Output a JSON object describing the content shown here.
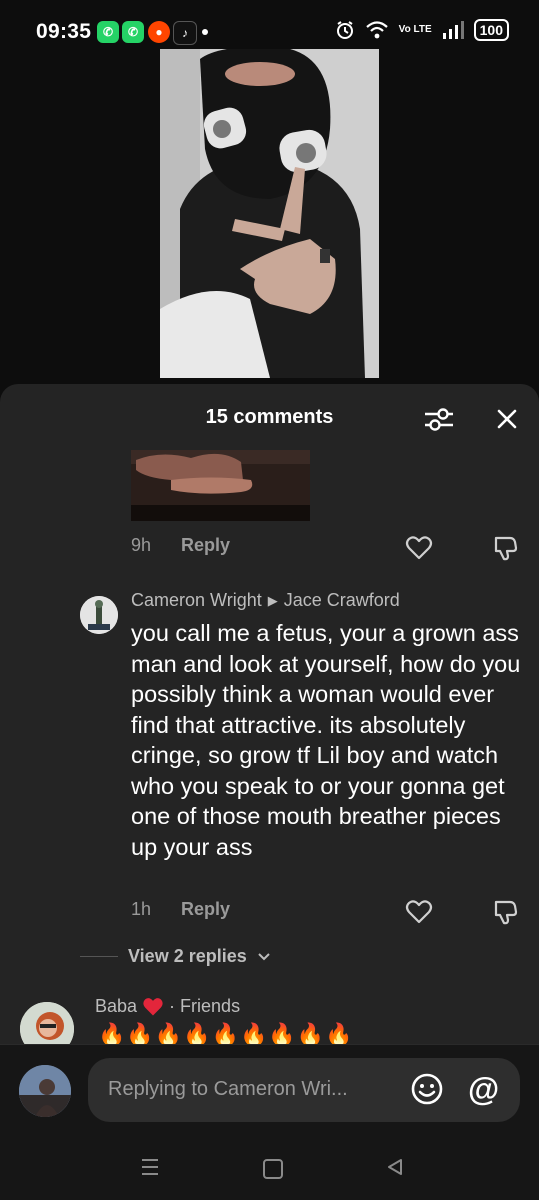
{
  "status_bar": {
    "time": "09:35",
    "notification_icons": [
      "whatsapp-icon",
      "whatsapp-business-icon",
      "reddit-icon",
      "tiktok-icon"
    ],
    "network": "Vo LTE",
    "battery": "100"
  },
  "comments_sheet": {
    "title": "15 comments",
    "previous_comment": {
      "time": "9h",
      "reply_label": "Reply"
    },
    "reply_comment": {
      "author": "Cameron Wright",
      "replying_to": "Jace Crawford",
      "text": "you call me a fetus, your a grown ass man and look at yourself, how do you possibly think a woman would ever find that attractive. its absolutely cringe, so grow tf Lil boy and watch who you speak to or your gonna get one of those mouth breather pieces up your ass",
      "time": "1h",
      "reply_label": "Reply"
    },
    "view_replies_label": "View 2 replies",
    "next_comment": {
      "author": "Baba",
      "relation": "· Friends",
      "text": "🔥🔥🔥🔥🔥🔥🔥🔥🔥"
    }
  },
  "input": {
    "placeholder": "Replying to Cameron Wri..."
  },
  "colors": {
    "sheet_background": "#242424",
    "muted_text": "#9a9a9a",
    "heart_red": "#e3263b"
  }
}
